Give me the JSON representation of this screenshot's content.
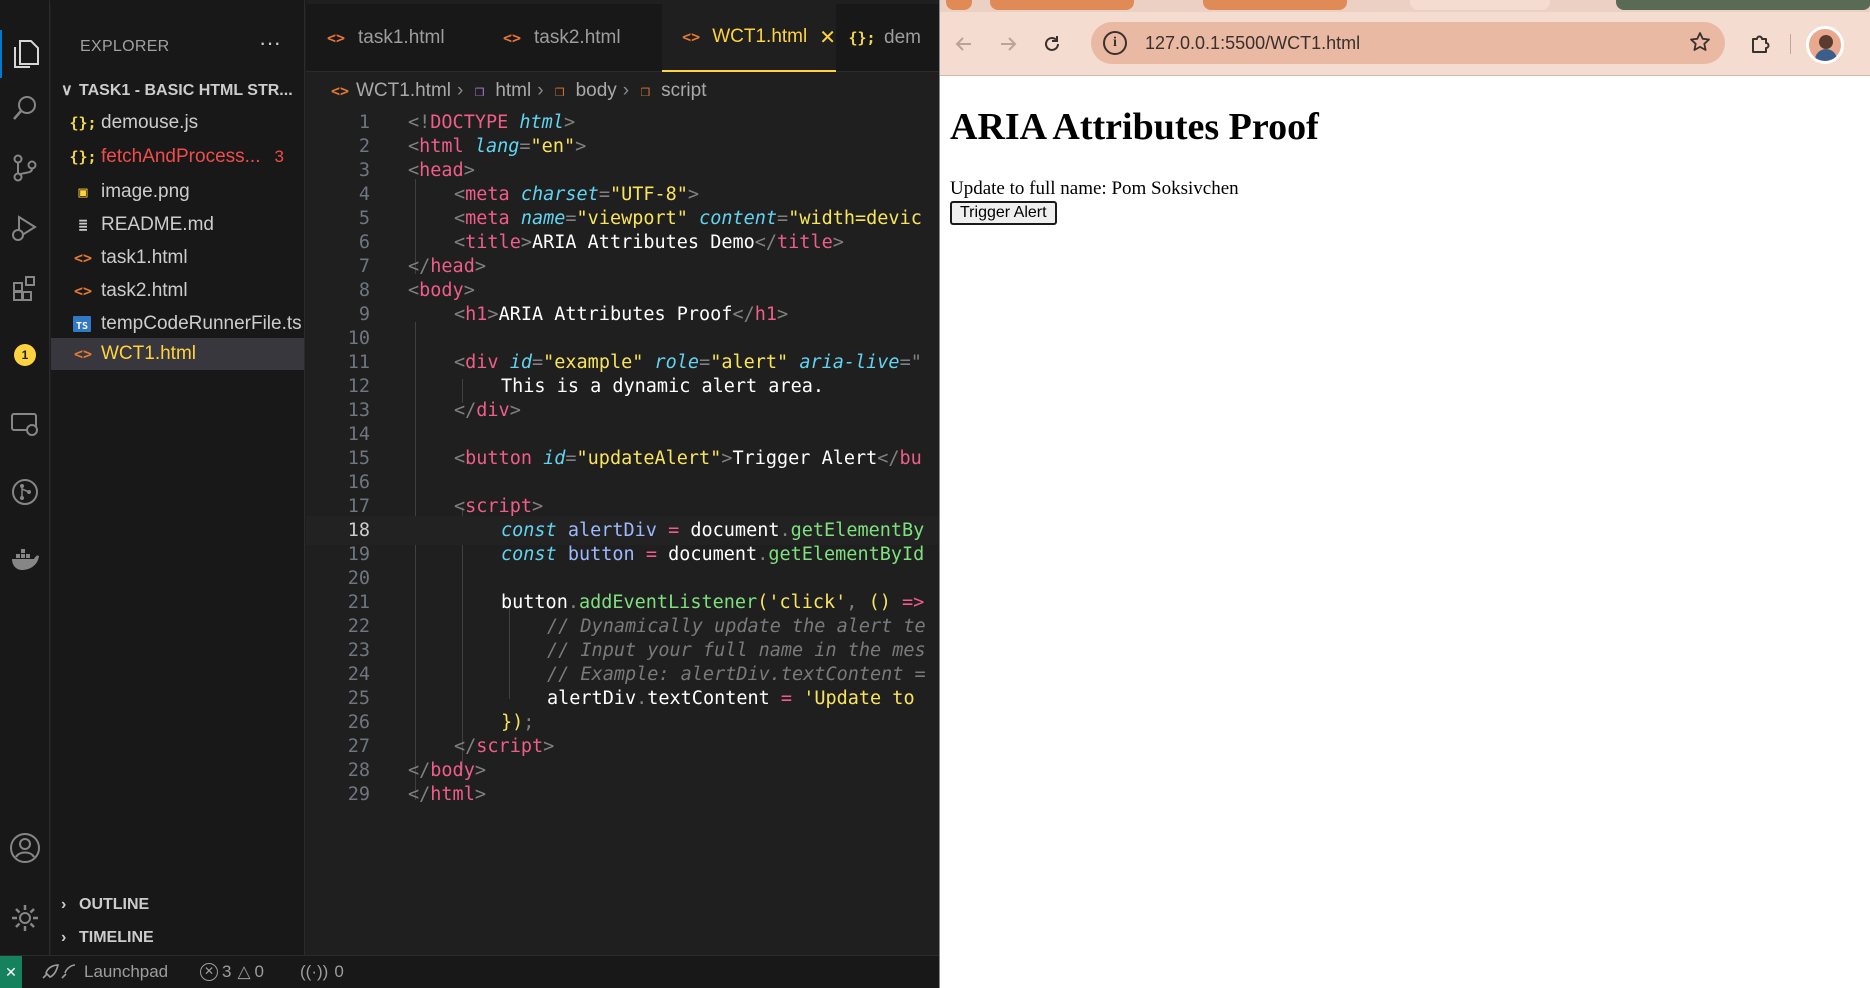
{
  "vscode": {
    "explorer": {
      "title": "EXPLORER",
      "more": "···",
      "workspace": "TASK1 - BASIC HTML STR...",
      "files": [
        {
          "name": "demouse.js",
          "icon": "js-file-icon",
          "glyph": "{};"
        },
        {
          "name": "fetchAndProcess...",
          "icon": "js-file-icon",
          "glyph": "{};",
          "problems": "3"
        },
        {
          "name": "image.png",
          "icon": "image-file-icon",
          "glyph": "▣"
        },
        {
          "name": "README.md",
          "icon": "markdown-file-icon",
          "glyph": "≣"
        },
        {
          "name": "task1.html",
          "icon": "html-file-icon",
          "glyph": "<>"
        },
        {
          "name": "task2.html",
          "icon": "html-file-icon",
          "glyph": "<>"
        },
        {
          "name": "tempCodeRunnerFile.ts",
          "icon": "ts-file-icon",
          "glyph": "TS"
        },
        {
          "name": "WCT1.html",
          "icon": "html-file-icon",
          "glyph": "<>"
        }
      ],
      "outline": "OUTLINE",
      "timeline": "TIMELINE"
    },
    "activity_badge": "1",
    "tabs": [
      {
        "label": "task1.html",
        "glyph": "<>"
      },
      {
        "label": "task2.html",
        "glyph": "<>"
      },
      {
        "label": "WCT1.html",
        "glyph": "<>",
        "close": "✕"
      },
      {
        "label": "dem",
        "glyph": "{};"
      }
    ],
    "breadcrumb": [
      "WCT1.html",
      "html",
      "body",
      "script"
    ],
    "line_numbers": [
      "1",
      "2",
      "3",
      "4",
      "5",
      "6",
      "7",
      "8",
      "9",
      "10",
      "11",
      "12",
      "13",
      "14",
      "15",
      "16",
      "17",
      "18",
      "19",
      "20",
      "21",
      "22",
      "23",
      "24",
      "25",
      "26",
      "27",
      "28",
      "29"
    ],
    "current_line": "18",
    "code": {
      "l1": [
        "<!",
        "DOCTYPE",
        " ",
        "html",
        ">"
      ],
      "l2": [
        "<",
        "html",
        " ",
        "lang",
        "=",
        "\"en\"",
        ">"
      ],
      "l3": [
        "<",
        "head",
        ">"
      ],
      "l4": [
        "<",
        "meta",
        " ",
        "charset",
        "=",
        "\"UTF-8\"",
        ">"
      ],
      "l5": [
        "<",
        "meta",
        " ",
        "name",
        "=",
        "\"viewport\"",
        " ",
        "content",
        "=",
        "\"width=devic"
      ],
      "l6": [
        "<",
        "title",
        ">",
        "ARIA Attributes Demo",
        "</",
        "title",
        ">"
      ],
      "l7": [
        "</",
        "head",
        ">"
      ],
      "l8": [
        "<",
        "body",
        ">"
      ],
      "l9": [
        "<",
        "h1",
        ">",
        "ARIA Attributes Proof",
        "</",
        "h1",
        ">"
      ],
      "l11": [
        "<",
        "div",
        " ",
        "id",
        "=",
        "\"example\"",
        " ",
        "role",
        "=",
        "\"alert\"",
        " ",
        "aria-live",
        "=\""
      ],
      "l12": "This is a dynamic alert area.",
      "l13": [
        "</",
        "div",
        ">"
      ],
      "l15": [
        "<",
        "button",
        " ",
        "id",
        "=",
        "\"updateAlert\"",
        ">",
        "Trigger Alert",
        "</",
        "bu"
      ],
      "l17": [
        "<",
        "script",
        ">"
      ],
      "l18": [
        "const",
        " ",
        "alertDiv",
        " ",
        "=",
        " ",
        "document",
        ".",
        "getElementBy"
      ],
      "l19": [
        "const",
        " ",
        "button",
        " ",
        "=",
        " ",
        "document",
        ".",
        "getElementById"
      ],
      "l21": [
        "button",
        ".",
        "addEventListener",
        "(",
        "'click'",
        ", ",
        "()",
        " =>"
      ],
      "l22": "// Dynamically update the alert te",
      "l23": "// Input your full name in the mes",
      "l24": "// Example: alertDiv.textContent =",
      "l25": [
        "alertDiv",
        ".",
        "textContent",
        " ",
        "=",
        " ",
        "'Update to"
      ],
      "l26": [
        "})",
        ";"
      ],
      "l27": [
        "</",
        "script",
        ">"
      ],
      "l28": [
        "</",
        "body",
        ">"
      ],
      "l29": [
        "</",
        "html",
        ">"
      ]
    },
    "status": {
      "remote_icon": "✕",
      "launchpad": "Launchpad",
      "errors": "3",
      "warnings": "0",
      "ports": "0"
    }
  },
  "browser": {
    "url": "127.0.0.1:5500/WCT1.html",
    "page": {
      "heading": "ARIA Attributes Proof",
      "alert_text": "Update to full name: Pom Soksivchen",
      "button_label": "Trigger Alert"
    }
  },
  "colors": {
    "vscode_accent": "#ffd23f",
    "browser_toolbar": "#f5dcd1",
    "omnibox": "#e9b9a3"
  }
}
